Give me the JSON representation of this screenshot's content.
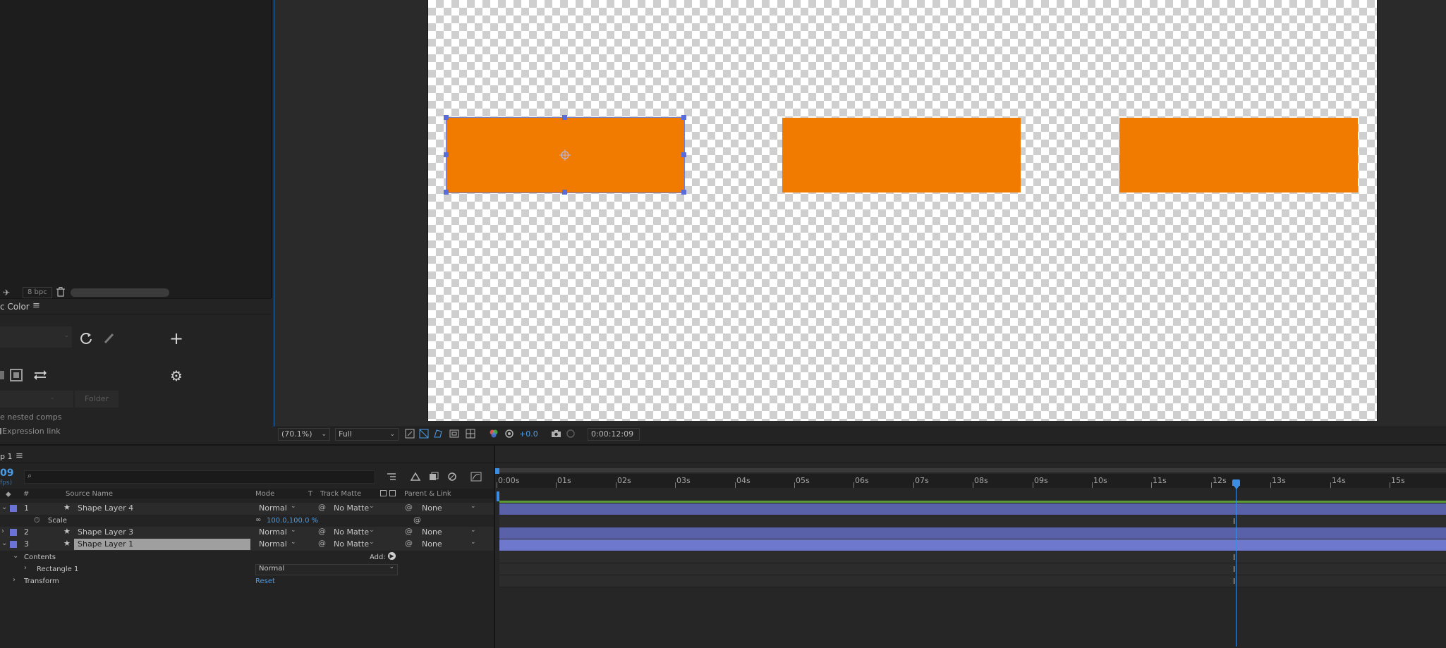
{
  "project_panel": {
    "bpc": "8 bpc",
    "panel_title": "c Color",
    "folder_label": "Folder",
    "checkbox_1": "e nested comps",
    "checkbox_2": "Expression link"
  },
  "viewer": {
    "zoom": "(70.1%)",
    "resolution": "Full",
    "exposure": "+0.0",
    "timecode": "0:00:12:09"
  },
  "timeline": {
    "comp_tab": "p 1",
    "current_time": "09",
    "fps_label": "fps)",
    "search_placeholder": "",
    "columns": {
      "num": "#",
      "source_name": "Source Name",
      "mode": "Mode",
      "t": "T",
      "track_matte": "Track Matte",
      "parent": "Parent & Link"
    },
    "layers": [
      {
        "num": "1",
        "name": "Shape Layer 4",
        "mode": "Normal",
        "matte": "No Matte",
        "parent": "None"
      },
      {
        "num": "2",
        "name": "Shape Layer 3",
        "mode": "Normal",
        "matte": "No Matte",
        "parent": "None"
      },
      {
        "num": "3",
        "name": "Shape Layer 1",
        "mode": "Normal",
        "matte": "No Matte",
        "parent": "None"
      }
    ],
    "scale_label": "Scale",
    "scale_value": "100.0,100.0 %",
    "contents_label": "Contents",
    "add_label": "Add:",
    "rectangle_label": "Rectangle 1",
    "rectangle_mode": "Normal",
    "transform_label": "Transform",
    "reset_label": "Reset",
    "ruler": [
      "0:00s",
      "01s",
      "02s",
      "03s",
      "04s",
      "05s",
      "06s",
      "07s",
      "08s",
      "09s",
      "10s",
      "11s",
      "12s",
      "13s",
      "14s",
      "15s"
    ]
  },
  "colors": {
    "accent": "#3b8ee4",
    "shape_fill": "#f07b00",
    "label_purple": "#6b74d6"
  }
}
